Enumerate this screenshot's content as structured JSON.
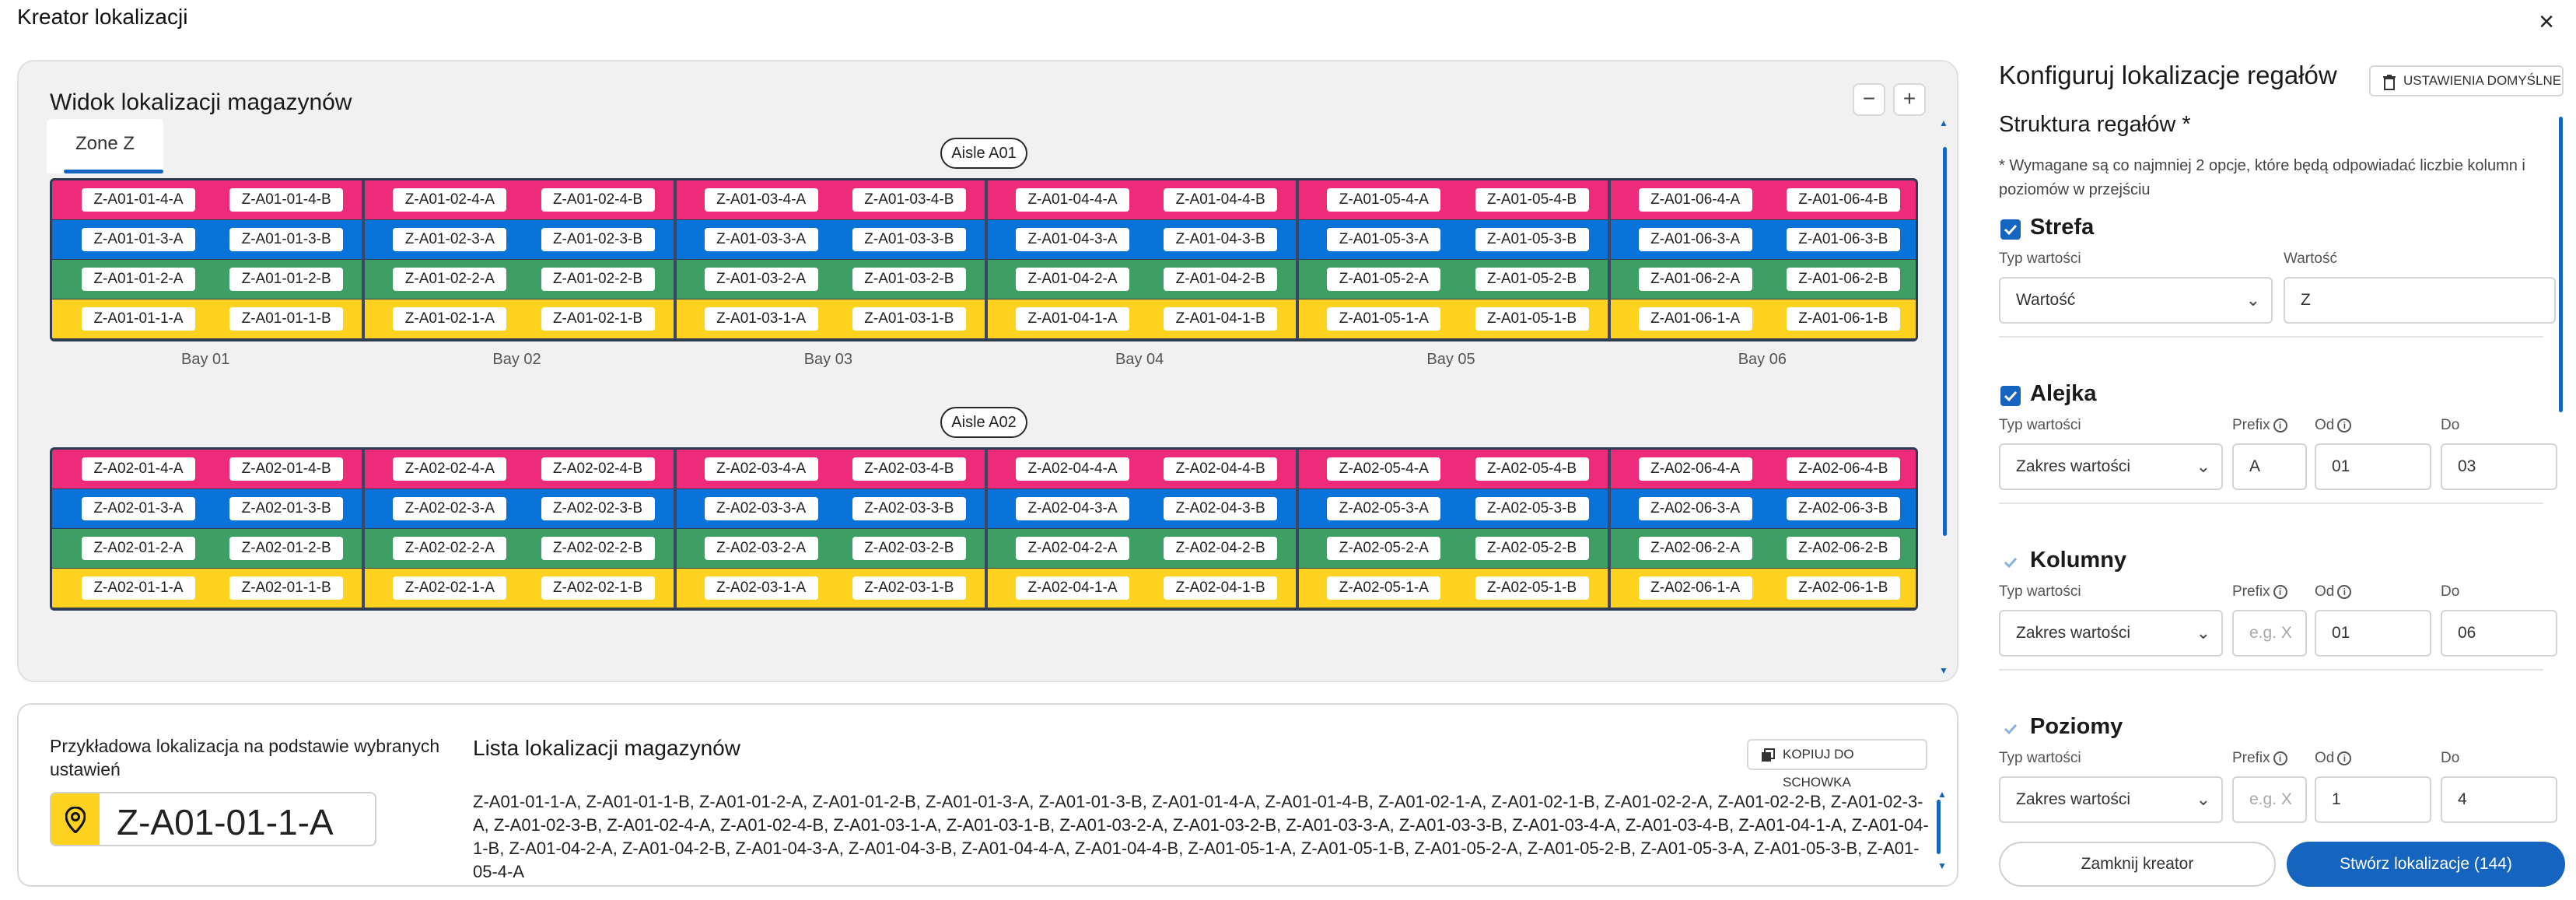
{
  "app": {
    "title": "Kreator lokalizacji"
  },
  "view": {
    "title": "Widok lokalizacji magazynów",
    "zoom_out": "−",
    "zoom_in": "+",
    "zone_tab": "Zone Z"
  },
  "colors": {
    "level_4": "#ee2a7b",
    "level_3": "#0a73d9",
    "level_2": "#3e9f64",
    "level_1": "#ffd21f",
    "accent": "#1565c0",
    "rack_frame": "#2e3a52"
  },
  "aisles": [
    {
      "label": "Aisle A01",
      "bays": [
        "Bay 01",
        "Bay 02",
        "Bay 03",
        "Bay 04",
        "Bay 05",
        "Bay 06"
      ],
      "rows": [
        [
          "Z-A01-01-4-A",
          "Z-A01-01-4-B",
          "Z-A01-02-4-A",
          "Z-A01-02-4-B",
          "Z-A01-03-4-A",
          "Z-A01-03-4-B",
          "Z-A01-04-4-A",
          "Z-A01-04-4-B",
          "Z-A01-05-4-A",
          "Z-A01-05-4-B",
          "Z-A01-06-4-A",
          "Z-A01-06-4-B"
        ],
        [
          "Z-A01-01-3-A",
          "Z-A01-01-3-B",
          "Z-A01-02-3-A",
          "Z-A01-02-3-B",
          "Z-A01-03-3-A",
          "Z-A01-03-3-B",
          "Z-A01-04-3-A",
          "Z-A01-04-3-B",
          "Z-A01-05-3-A",
          "Z-A01-05-3-B",
          "Z-A01-06-3-A",
          "Z-A01-06-3-B"
        ],
        [
          "Z-A01-01-2-A",
          "Z-A01-01-2-B",
          "Z-A01-02-2-A",
          "Z-A01-02-2-B",
          "Z-A01-03-2-A",
          "Z-A01-03-2-B",
          "Z-A01-04-2-A",
          "Z-A01-04-2-B",
          "Z-A01-05-2-A",
          "Z-A01-05-2-B",
          "Z-A01-06-2-A",
          "Z-A01-06-2-B"
        ],
        [
          "Z-A01-01-1-A",
          "Z-A01-01-1-B",
          "Z-A01-02-1-A",
          "Z-A01-02-1-B",
          "Z-A01-03-1-A",
          "Z-A01-03-1-B",
          "Z-A01-04-1-A",
          "Z-A01-04-1-B",
          "Z-A01-05-1-A",
          "Z-A01-05-1-B",
          "Z-A01-06-1-A",
          "Z-A01-06-1-B"
        ]
      ]
    },
    {
      "label": "Aisle A02",
      "bays": [],
      "rows": [
        [
          "Z-A02-01-4-A",
          "Z-A02-01-4-B",
          "Z-A02-02-4-A",
          "Z-A02-02-4-B",
          "Z-A02-03-4-A",
          "Z-A02-03-4-B",
          "Z-A02-04-4-A",
          "Z-A02-04-4-B",
          "Z-A02-05-4-A",
          "Z-A02-05-4-B",
          "Z-A02-06-4-A",
          "Z-A02-06-4-B"
        ],
        [
          "Z-A02-01-3-A",
          "Z-A02-01-3-B",
          "Z-A02-02-3-A",
          "Z-A02-02-3-B",
          "Z-A02-03-3-A",
          "Z-A02-03-3-B",
          "Z-A02-04-3-A",
          "Z-A02-04-3-B",
          "Z-A02-05-3-A",
          "Z-A02-05-3-B",
          "Z-A02-06-3-A",
          "Z-A02-06-3-B"
        ],
        [
          "Z-A02-01-2-A",
          "Z-A02-01-2-B",
          "Z-A02-02-2-A",
          "Z-A02-02-2-B",
          "Z-A02-03-2-A",
          "Z-A02-03-2-B",
          "Z-A02-04-2-A",
          "Z-A02-04-2-B",
          "Z-A02-05-2-A",
          "Z-A02-05-2-B",
          "Z-A02-06-2-A",
          "Z-A02-06-2-B"
        ],
        [
          "Z-A02-01-1-A",
          "Z-A02-01-1-B",
          "Z-A02-02-1-A",
          "Z-A02-02-1-B",
          "Z-A02-03-1-A",
          "Z-A02-03-1-B",
          "Z-A02-04-1-A",
          "Z-A02-04-1-B",
          "Z-A02-05-1-A",
          "Z-A02-05-1-B",
          "Z-A02-06-1-A",
          "Z-A02-06-1-B"
        ]
      ]
    }
  ],
  "example": {
    "title": "Przykładowa lokalizacja na podstawie wybranych ustawień",
    "icon": "location-pin-icon",
    "value": "Z-A01-01-1-A"
  },
  "list": {
    "title": "Lista lokalizacji magazynów",
    "copy_label": "KOPIUJ DO SCHOWKA",
    "text": "Z-A01-01-1-A, Z-A01-01-1-B, Z-A01-01-2-A, Z-A01-01-2-B, Z-A01-01-3-A, Z-A01-01-3-B, Z-A01-01-4-A, Z-A01-01-4-B, Z-A01-02-1-A, Z-A01-02-1-B, Z-A01-02-2-A, Z-A01-02-2-B, Z-A01-02-3-A, Z-A01-02-3-B, Z-A01-02-4-A, Z-A01-02-4-B, Z-A01-03-1-A, Z-A01-03-1-B, Z-A01-03-2-A, Z-A01-03-2-B, Z-A01-03-3-A, Z-A01-03-3-B, Z-A01-03-4-A, Z-A01-03-4-B, Z-A01-04-1-A, Z-A01-04-1-B, Z-A01-04-2-A, Z-A01-04-2-B, Z-A01-04-3-A, Z-A01-04-3-B, Z-A01-04-4-A, Z-A01-04-4-B, Z-A01-05-1-A, Z-A01-05-1-B, Z-A01-05-2-A, Z-A01-05-2-B, Z-A01-05-3-A, Z-A01-05-3-B, Z-A01-05-4-A"
  },
  "config": {
    "title": "Konfiguruj lokalizacje regałów",
    "defaults_label": "USTAWIENIA DOMYŚLNE",
    "structure_title": "Struktura regałów *",
    "structure_note": "* Wymagane są co najmniej 2 opcje, które będą odpowiadać liczbie kolumn i poziomów w przejściu",
    "sections": {
      "strefa": {
        "title": "Strefa",
        "checked": true,
        "type_label": "Typ wartości",
        "type_value": "Wartość",
        "value_label": "Wartość",
        "value": "Z"
      },
      "alejka": {
        "title": "Alejka",
        "checked": true,
        "type_label": "Typ wartości",
        "type_value": "Zakres wartości",
        "prefix_label": "Prefix",
        "prefix_value": "A",
        "from_label": "Od",
        "from_value": "01",
        "to_label": "Do",
        "to_value": "03"
      },
      "kolumny": {
        "title": "Kolumny",
        "checked": false,
        "type_label": "Typ wartości",
        "type_value": "Zakres wartości",
        "prefix_label": "Prefix",
        "prefix_placeholder": "e.g. X",
        "from_label": "Od",
        "from_value": "01",
        "to_label": "Do",
        "to_value": "06"
      },
      "poziomy": {
        "title": "Poziomy",
        "checked": false,
        "type_label": "Typ wartości",
        "type_value": "Zakres wartości",
        "prefix_label": "Prefix",
        "prefix_placeholder": "e.g. X",
        "from_label": "Od",
        "from_value": "1",
        "to_label": "Do",
        "to_value": "4"
      }
    }
  },
  "footer": {
    "close_label": "Zamknij kreator",
    "create_label": "Stwórz lokalizacje (144)"
  }
}
